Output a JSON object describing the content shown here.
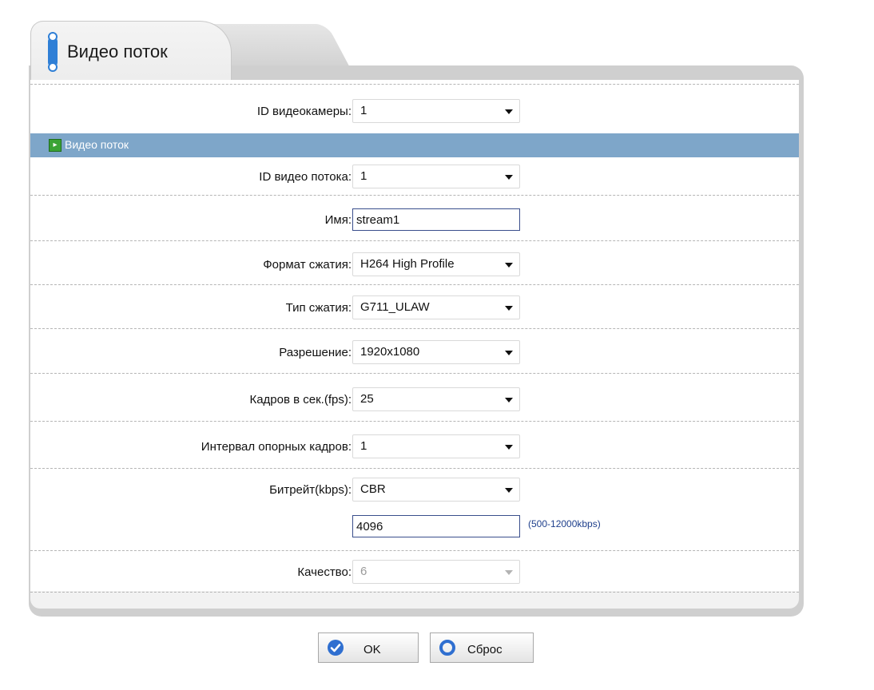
{
  "tab": {
    "title": "Видео поток"
  },
  "camera": {
    "label": "ID видеокамеры:",
    "value": "1"
  },
  "section": {
    "label": "Видео поток"
  },
  "fields": {
    "stream_id": {
      "label": "ID видео потока:",
      "value": "1"
    },
    "name": {
      "label": "Имя:",
      "value": "stream1"
    },
    "compression_format": {
      "label": "Формат сжатия:",
      "value": "H264 High Profile"
    },
    "audio_compression": {
      "label": "Тип сжатия:",
      "value": "G711_ULAW"
    },
    "resolution": {
      "label": "Разрешение:",
      "value": "1920x1080"
    },
    "fps": {
      "label": "Кадров в сек.(fps):",
      "value": "25"
    },
    "keyframe_interval": {
      "label": "Интервал опорных кадров:",
      "value": "1"
    },
    "bitrate_mode": {
      "label": "Битрейт(kbps):",
      "value": "CBR"
    },
    "bitrate_value": {
      "value": "4096",
      "hint": "(500-12000kbps)"
    },
    "quality": {
      "label": "Качество:",
      "value": "6"
    }
  },
  "buttons": {
    "ok": "OK",
    "reset": "Сброс"
  },
  "colors": {
    "section_bar": "#7ea6c9",
    "ok_icon": "#2f6fd0",
    "reset_icon": "#2f6fd0"
  }
}
